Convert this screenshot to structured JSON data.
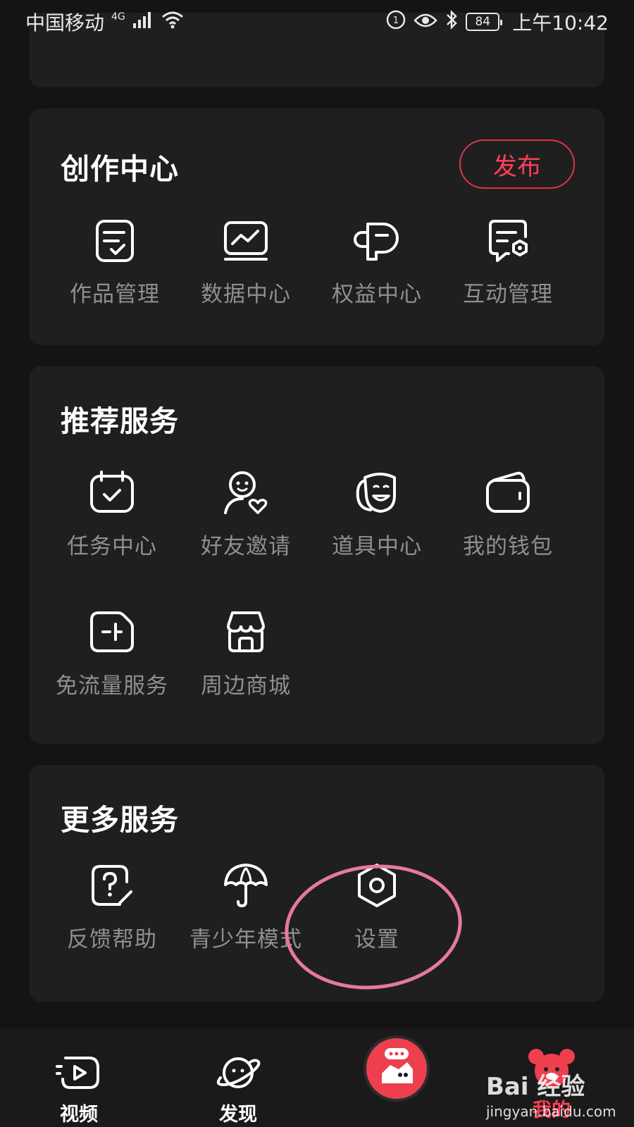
{
  "status_bar": {
    "carrier": "中国移动",
    "network": "4G",
    "battery": "84",
    "time": "上午10:42"
  },
  "create_center": {
    "title": "创作中心",
    "publish_label": "发布",
    "items": [
      {
        "label": "作品管理",
        "icon": "works-manage-icon"
      },
      {
        "label": "数据中心",
        "icon": "data-chart-icon"
      },
      {
        "label": "权益中心",
        "icon": "benefits-icon"
      },
      {
        "label": "互动管理",
        "icon": "interaction-manage-icon"
      }
    ]
  },
  "recommended": {
    "title": "推荐服务",
    "items": [
      {
        "label": "任务中心",
        "icon": "task-calendar-icon"
      },
      {
        "label": "好友邀请",
        "icon": "friend-invite-icon"
      },
      {
        "label": "道具中心",
        "icon": "props-mask-icon"
      },
      {
        "label": "我的钱包",
        "icon": "wallet-icon"
      },
      {
        "label": "免流量服务",
        "icon": "sim-card-icon"
      },
      {
        "label": "周边商城",
        "icon": "shop-icon"
      }
    ]
  },
  "more_services": {
    "title": "更多服务",
    "items": [
      {
        "label": "反馈帮助",
        "icon": "feedback-help-icon"
      },
      {
        "label": "青少年模式",
        "icon": "umbrella-icon"
      },
      {
        "label": "设置",
        "icon": "settings-hexagon-icon"
      }
    ]
  },
  "bottom_nav": {
    "items": [
      {
        "label": "视频",
        "icon": "video-play-icon"
      },
      {
        "label": "发现",
        "icon": "planet-icon"
      },
      {
        "label": "",
        "icon": "create-center-icon"
      },
      {
        "label": "我的",
        "icon": "profile-bear-icon"
      }
    ]
  },
  "watermark": {
    "logo": "Bai 经验",
    "url": "jingyan.baidu.com"
  },
  "colors": {
    "background": "#141414",
    "card": "#1f1f1f",
    "accent": "#ff3f57",
    "label": "#8f8f8f",
    "highlight": "#e77a98"
  }
}
